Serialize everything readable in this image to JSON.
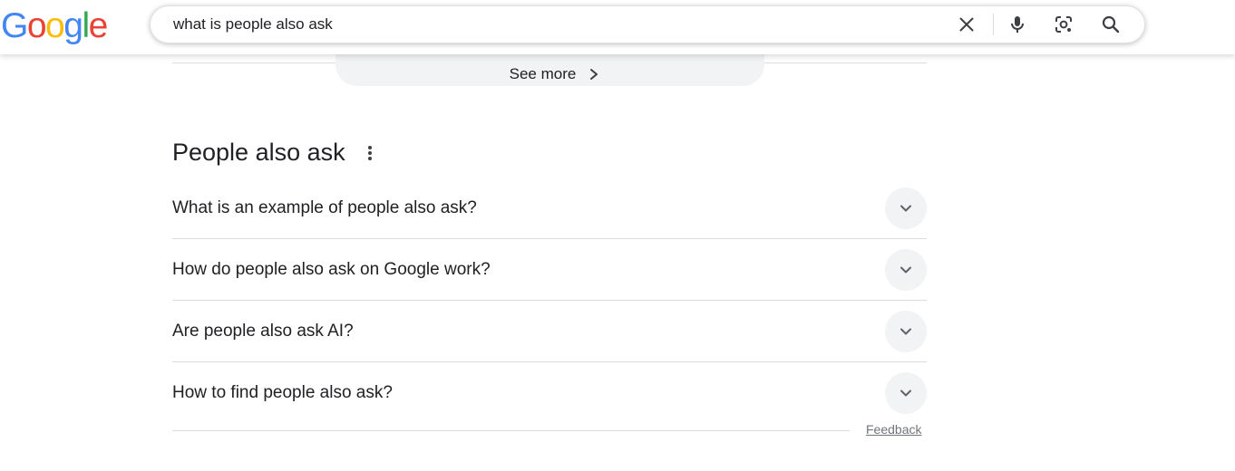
{
  "header": {
    "logo_text": "Google",
    "logo_colors": [
      "#4285F4",
      "#EA4335",
      "#FBBC05",
      "#4285F4",
      "#34A853",
      "#EA4335"
    ],
    "search_value": "what is people also ask",
    "icons": [
      "close-icon",
      "microphone-icon",
      "lens-camera-icon",
      "search-icon"
    ]
  },
  "see_more": {
    "label": "See more",
    "icon": "chevron-right-icon"
  },
  "paa": {
    "title": "People also ask",
    "menu_icon": "more-vert-icon",
    "questions": [
      "What is an example of people also ask?",
      "How do people also ask on Google work?",
      "Are people also ask AI?",
      "How to find people also ask?"
    ],
    "expand_icon": "chevron-down-icon"
  },
  "footer": {
    "feedback_label": "Feedback"
  },
  "colors": {
    "text": "#202124",
    "muted": "#70757a",
    "divider": "#dadce0",
    "chip_bg": "#f1f3f4"
  }
}
